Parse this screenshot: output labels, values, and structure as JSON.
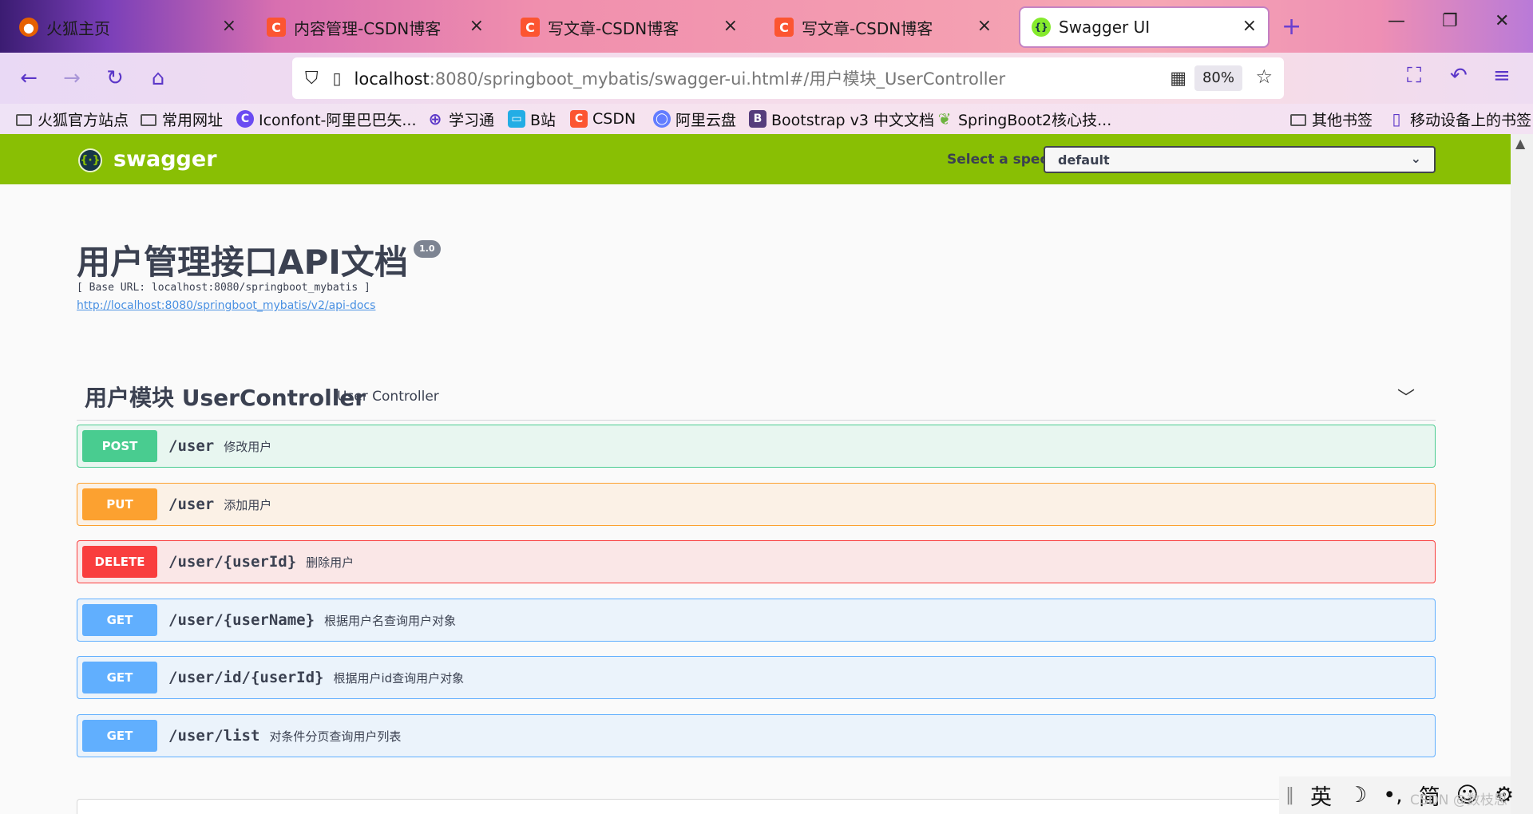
{
  "browser": {
    "tabs": [
      {
        "label": "火狐主页",
        "icon": "firefox-icon",
        "color": "#e66000"
      },
      {
        "label": "内容管理-CSDN博客",
        "icon": "csdn-icon",
        "color": "#fc5531"
      },
      {
        "label": "写文章-CSDN博客",
        "icon": "csdn-icon",
        "color": "#fc5531"
      },
      {
        "label": "写文章-CSDN博客",
        "icon": "csdn-icon",
        "color": "#fc5531"
      },
      {
        "label": "Swagger UI",
        "icon": "swagger-icon",
        "color": "#85ea2d"
      }
    ],
    "new_tab": "+",
    "close_glyph": "×",
    "url_host": "localhost",
    "url_rest": ":8080/springboot_mybatis/swagger-ui.html#/用户模块_UserController",
    "zoom": "80%",
    "bookmarks": [
      {
        "label": "火狐官方站点",
        "icon": "folder-icon"
      },
      {
        "label": "常用网址",
        "icon": "folder-icon"
      },
      {
        "label": "Iconfont-阿里巴巴矢...",
        "icon": "iconfont-icon"
      },
      {
        "label": "学习通",
        "icon": "globe-icon"
      },
      {
        "label": "B站",
        "icon": "bilibili-icon"
      },
      {
        "label": "CSDN",
        "icon": "csdn-icon"
      },
      {
        "label": "阿里云盘",
        "icon": "aliyun-icon"
      },
      {
        "label": "Bootstrap v3 中文文档",
        "icon": "bootstrap-icon"
      },
      {
        "label": "SpringBoot2核心技...",
        "icon": "spring-icon"
      },
      {
        "label": "其他书签",
        "icon": "folder-icon"
      },
      {
        "label": "移动设备上的书签",
        "icon": "mobile-icon"
      }
    ]
  },
  "swagger": {
    "brand": "swagger",
    "spec_label": "Select a spec",
    "spec_value": "default",
    "title": "用户管理接口API文档",
    "version": "1.0",
    "base_url": "[ Base URL: localhost:8080/springboot_mybatis ]",
    "api_docs_link": "http://localhost:8080/springboot_mybatis/v2/api-docs",
    "tag": {
      "name": "用户模块 UserController",
      "description": "User Controller"
    },
    "operations": [
      {
        "method": "POST",
        "path": "/user",
        "summary": "修改用户"
      },
      {
        "method": "PUT",
        "path": "/user",
        "summary": "添加用户"
      },
      {
        "method": "DELETE",
        "path": "/user/{userId}",
        "summary": "删除用户"
      },
      {
        "method": "GET",
        "path": "/user/{userName}",
        "summary": "根据用户名查询用户对象"
      },
      {
        "method": "GET",
        "path": "/user/id/{userId}",
        "summary": "根据用户id查询用户对象"
      },
      {
        "method": "GET",
        "path": "/user/list",
        "summary": "对条件分页查询用户列表"
      }
    ]
  },
  "ime": {
    "lang": "英",
    "moon": "☽",
    "punct": "•,",
    "script": "简",
    "emoji": "☺",
    "settings": "⚙"
  },
  "watermark": "CSDN @数枝思"
}
